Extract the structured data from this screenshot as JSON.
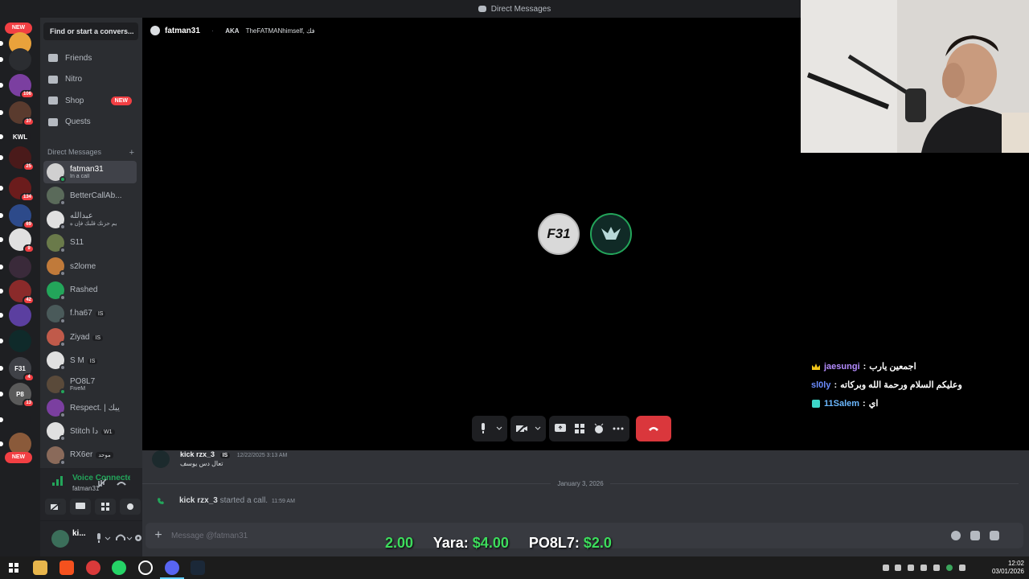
{
  "window": {
    "title": "Direct Messages"
  },
  "guilds": [
    {
      "label": "",
      "badge": "",
      "color": "#e9a23b"
    },
    {
      "label": "",
      "badge": "",
      "color": "#2b2d31"
    },
    {
      "label": "",
      "badge": "106",
      "color": "#7b3fa0"
    },
    {
      "label": "",
      "badge": "37",
      "color": "#5a3b2e"
    },
    {
      "label": "KWL",
      "badge": "",
      "color": "#1e1f22"
    },
    {
      "label": "",
      "badge": "25",
      "color": "#4a1a1a"
    },
    {
      "label": "",
      "badge": "134",
      "color": "#6b1c1c"
    },
    {
      "label": "",
      "badge": "69",
      "color": "#2d4a8a"
    },
    {
      "label": "",
      "badge": "9",
      "color": "#e0e0e0"
    },
    {
      "label": "",
      "badge": "",
      "color": "#3a2a3a"
    },
    {
      "label": "",
      "badge": "42",
      "color": "#8a2a2a"
    },
    {
      "label": "",
      "badge": "",
      "color": "#5b3fa0"
    },
    {
      "label": "",
      "badge": "",
      "color": "#0f2a2a"
    },
    {
      "label": "F31",
      "badge": "4",
      "color": "#3f4147"
    },
    {
      "label": "P8",
      "badge": "13",
      "color": "#5a5a5a"
    },
    {
      "label": "",
      "badge": "",
      "color": "#1e1f22"
    },
    {
      "label": "",
      "badge": "",
      "color": "#8a5a3a"
    }
  ],
  "new_pill": "NEW",
  "dm_sidebar": {
    "search_placeholder": "Find or start a convers...",
    "nav": [
      {
        "label": "Friends",
        "badge": ""
      },
      {
        "label": "Nitro",
        "badge": ""
      },
      {
        "label": "Shop",
        "badge": "NEW"
      },
      {
        "label": "Quests",
        "badge": ""
      }
    ],
    "header": "Direct Messages",
    "add_symbol": "+",
    "dms": [
      {
        "name": "fatman31",
        "sub": "In a call",
        "tag": "",
        "active": true,
        "online": true,
        "color": "#d0d0d0"
      },
      {
        "name": "BetterCallAb...",
        "sub": "",
        "tag": "",
        "active": false,
        "online": false,
        "color": "#5a6a5a"
      },
      {
        "name": "عبدالله",
        "sub": "يم حزنك قلبك فإن ه",
        "tag": "",
        "active": false,
        "online": false,
        "color": "#e0e0e0"
      },
      {
        "name": "S11",
        "sub": "",
        "tag": "",
        "active": false,
        "online": false,
        "color": "#6a7a4a"
      },
      {
        "name": "s2lome",
        "sub": "",
        "tag": "",
        "active": false,
        "online": false,
        "color": "#c07a3a"
      },
      {
        "name": "Rashed",
        "sub": "",
        "tag": "",
        "active": false,
        "online": false,
        "color": "#23a55a"
      },
      {
        "name": "f.ha67",
        "sub": "",
        "tag": "IS",
        "active": false,
        "online": false,
        "color": "#4a5a5a"
      },
      {
        "name": "Ziyad",
        "sub": "",
        "tag": "IS",
        "active": false,
        "online": false,
        "color": "#c05a4a"
      },
      {
        "name": "S M",
        "sub": "",
        "tag": "IS",
        "active": false,
        "online": false,
        "color": "#e0e0e0"
      },
      {
        "name": "PO8L7",
        "sub": "FiveM",
        "tag": "",
        "active": false,
        "online": true,
        "color": "#5a4a3a"
      },
      {
        "name": "Respect. | يبك",
        "sub": "",
        "tag": "",
        "active": false,
        "online": false,
        "color": "#7b3fa0"
      },
      {
        "name": "Stitch دا",
        "sub": "",
        "tag": "W1",
        "active": false,
        "online": false,
        "color": "#e0e0e0"
      },
      {
        "name": "RX6er",
        "sub": "",
        "tag": "موحد",
        "active": false,
        "online": false,
        "color": "#8a6a5a"
      }
    ]
  },
  "voice": {
    "status": "Voice Connected",
    "channel": "fatman31"
  },
  "user": {
    "name": "ki..."
  },
  "channel_header": {
    "name": "fatman31",
    "aka_label": "AKA",
    "aka_value": "TheFATMANhimself, فك"
  },
  "call": {
    "avatars": [
      {
        "text": "F31",
        "bg": "#d9d9d9",
        "ring": "#b8b8b8"
      },
      {
        "text": "",
        "bg": "#102a26",
        "ring": "#23a55a"
      }
    ]
  },
  "twitch_chat": [
    {
      "user": "jaesungi",
      "sep": ":",
      "text": "اجمعين يارب",
      "color": "#b48cff",
      "icon": "crown"
    },
    {
      "user": "sl0ly",
      "sep": ":",
      "text": "وعليكم السلام ورحمة الله وبركاته",
      "color": "#6b8cff",
      "icon": ""
    },
    {
      "user": "11Salem",
      "sep": ":",
      "text": "اي",
      "color": "#6bb8ff",
      "icon": "badge"
    }
  ],
  "messages": {
    "prev": {
      "author": "kick rzx_3",
      "tag": "IS",
      "time": "12/22/2025 3:13 AM",
      "text": "تعال دس يوسف"
    },
    "date_divider": "January 3, 2026",
    "call_event": {
      "author": "kick rzx_3",
      "action": "started a call.",
      "time": "11:59 AM"
    },
    "input_placeholder": "Message @fatman31"
  },
  "ticker": {
    "a_value": "2.00",
    "b_name": "Yara:",
    "b_value": "$4.00",
    "c_name": "PO8L7:",
    "c_value": "$2.0"
  },
  "taskbar": {
    "time": "12:02",
    "date": "03/01/2026"
  },
  "colors": {
    "accent_green": "#23a55a",
    "danger": "#da373c",
    "brand": "#5865f2"
  }
}
